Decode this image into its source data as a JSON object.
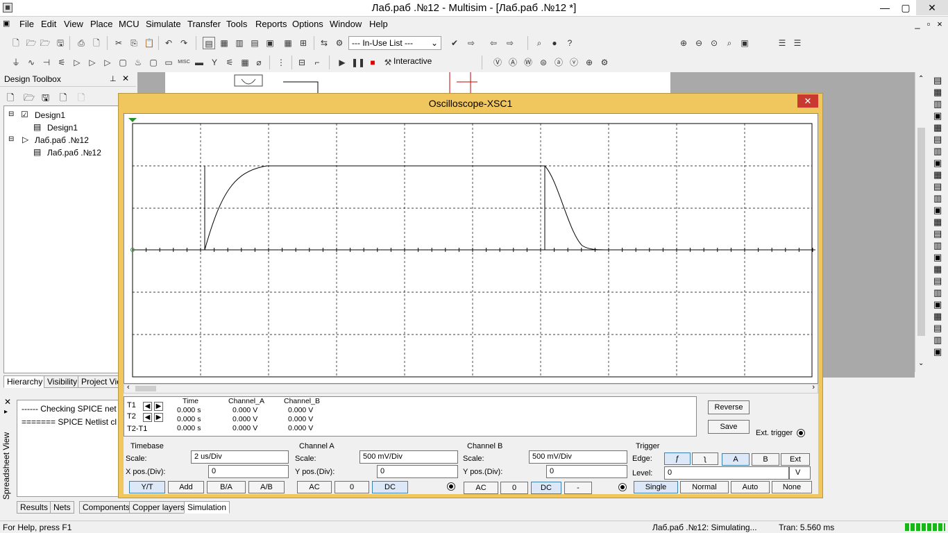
{
  "window": {
    "title": "Лаб.раб .№12 - Multisim - [Лаб.раб .№12 *]",
    "min": "—",
    "max": "▢",
    "close": "✕"
  },
  "menu": [
    "File",
    "Edit",
    "View",
    "Place",
    "MCU",
    "Simulate",
    "Transfer",
    "Tools",
    "Reports",
    "Options",
    "Window",
    "Help"
  ],
  "mdi_controls": [
    "_",
    "▫",
    "×"
  ],
  "toolbar": {
    "in_use_list": "--- In-Use List ---",
    "interactive": "Interactive"
  },
  "design_toolbox": {
    "title": "Design Toolbox",
    "tree": [
      "Design1",
      "Design1",
      "Лаб.раб .№12",
      "Лаб.раб .№12"
    ],
    "tabs": [
      "Hierarchy",
      "Visibility",
      "Project View"
    ]
  },
  "output": {
    "lines": [
      "------ Checking SPICE net",
      "======= SPICE Netlist cl"
    ],
    "side_label": "Spreadsheet View"
  },
  "bottom_tabs": [
    "Results",
    "Nets",
    "Components",
    "Copper layers",
    "Simulation"
  ],
  "status": {
    "help": "For Help, press F1",
    "sim": "Лаб.раб .№12: Simulating...",
    "tran": "Tran: 5.560 ms"
  },
  "oscilloscope": {
    "title": "Oscilloscope-XSC1",
    "readout": {
      "headers": [
        "Time",
        "Channel_A",
        "Channel_B"
      ],
      "rows": [
        {
          "label": "T1",
          "time": "0.000 s",
          "a": "0.000 V",
          "b": "0.000 V"
        },
        {
          "label": "T2",
          "time": "0.000 s",
          "a": "0.000 V",
          "b": "0.000 V"
        },
        {
          "label": "T2-T1",
          "time": "0.000 s",
          "a": "0.000 V",
          "b": "0.000 V"
        }
      ]
    },
    "reverse": "Reverse",
    "save": "Save",
    "ext_trigger": "Ext. trigger",
    "timebase": {
      "title": "Timebase",
      "scale_label": "Scale:",
      "scale": "2 us/Div",
      "xpos_label": "X pos.(Div):",
      "xpos": "0",
      "buttons": [
        "Y/T",
        "Add",
        "B/A",
        "A/B"
      ]
    },
    "channel_a": {
      "title": "Channel A",
      "scale_label": "Scale:",
      "scale": "500 mV/Div",
      "ypos_label": "Y pos.(Div):",
      "ypos": "0",
      "buttons": [
        "AC",
        "0",
        "DC"
      ]
    },
    "channel_b": {
      "title": "Channel B",
      "scale_label": "Scale:",
      "scale": "500 mV/Div",
      "ypos_label": "Y pos.(Div):",
      "ypos": "0",
      "buttons": [
        "AC",
        "0",
        "DC",
        "-"
      ]
    },
    "trigger": {
      "title": "Trigger",
      "edge_label": "Edge:",
      "edge_buttons": [
        "ƒ",
        "ʅ",
        "A",
        "B",
        "Ext"
      ],
      "level_label": "Level:",
      "level": "0",
      "level_unit": "V",
      "modes": [
        "Single",
        "Normal",
        "Auto",
        "None"
      ]
    }
  }
}
